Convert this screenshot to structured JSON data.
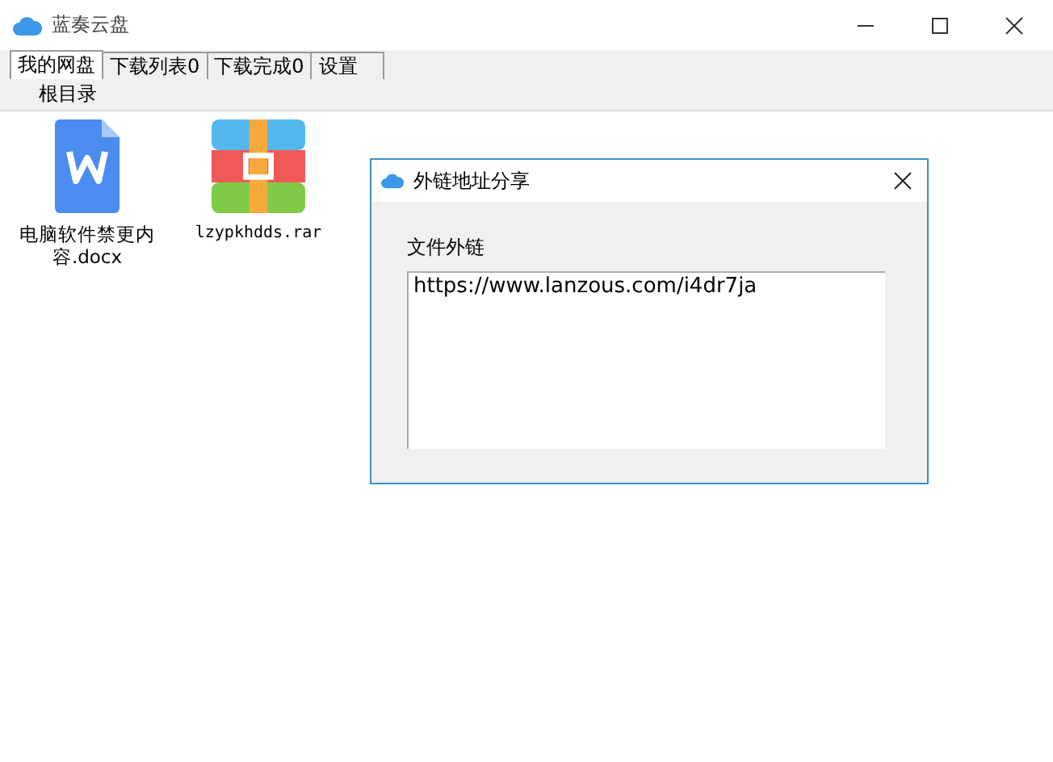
{
  "window": {
    "title": "蓝奏云盘"
  },
  "tabs": [
    {
      "label": "我的网盘",
      "selected": true
    },
    {
      "label": "下载列表0",
      "selected": false
    },
    {
      "label": "下载完成0",
      "selected": false
    },
    {
      "label": "设置",
      "selected": false
    }
  ],
  "breadcrumb": "根目录",
  "files": [
    {
      "name": "电脑软件禁更内容.docx",
      "kind": "word"
    },
    {
      "name": "lzypkhdds.rar",
      "kind": "archive"
    }
  ],
  "dialog": {
    "title": "外链地址分享",
    "field_label": "文件外链",
    "value": "https://www.lanzous.com/i4dr7ja"
  }
}
